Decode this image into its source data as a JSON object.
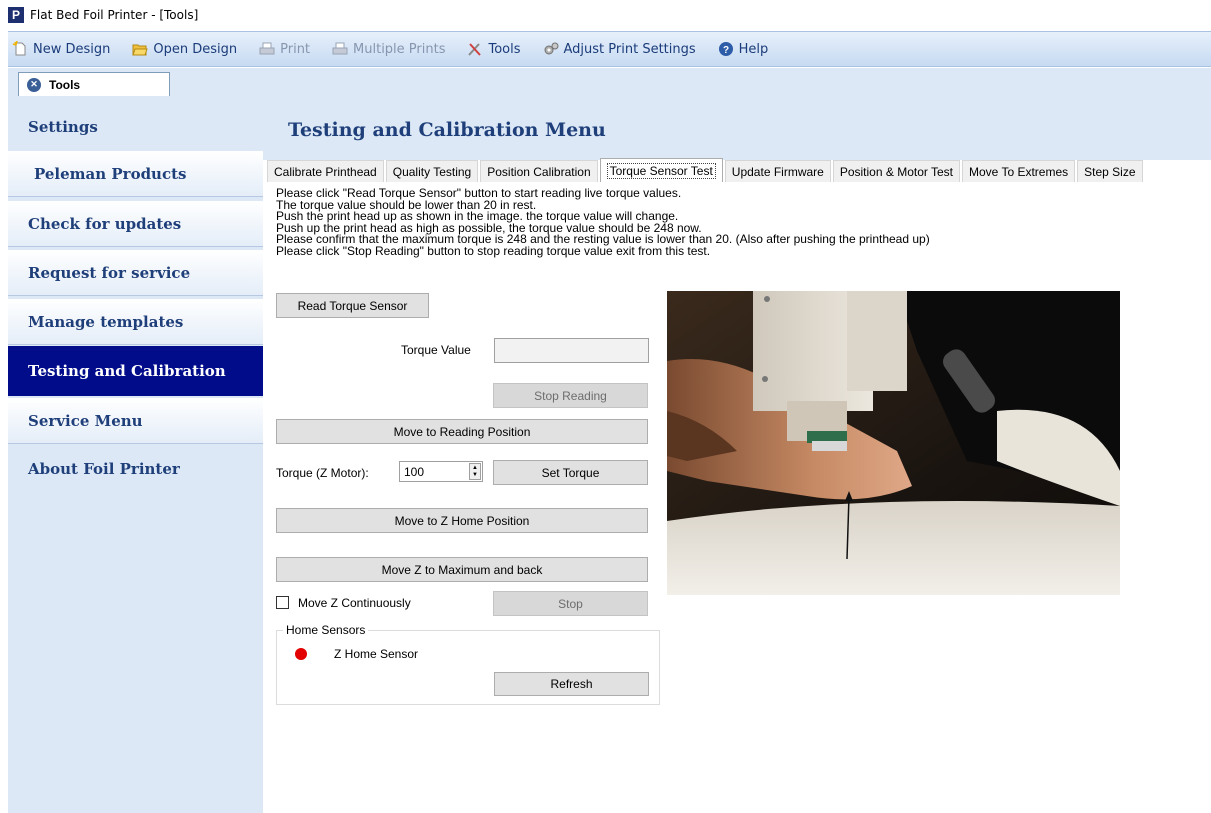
{
  "window": {
    "title": "Flat Bed Foil Printer - [Tools]",
    "app_icon_letter": "P"
  },
  "toolbar": {
    "new_design": "New Design",
    "open_design": "Open Design",
    "print": "Print",
    "multiple_prints": "Multiple Prints",
    "tools": "Tools",
    "adjust_print_settings": "Adjust Print Settings",
    "help": "Help"
  },
  "doc_tab": {
    "label": "Tools"
  },
  "sidebar": {
    "items": [
      {
        "label": "Settings"
      },
      {
        "label": "Peleman Products"
      },
      {
        "label": "Check for updates"
      },
      {
        "label": "Request for service"
      },
      {
        "label": "Manage templates"
      },
      {
        "label": "Testing and Calibration"
      },
      {
        "label": "Service Menu"
      },
      {
        "label": "About Foil Printer"
      }
    ]
  },
  "main": {
    "title": "Testing and Calibration Menu",
    "tabs": [
      {
        "label": "Calibrate Printhead"
      },
      {
        "label": "Quality Testing"
      },
      {
        "label": "Position Calibration"
      },
      {
        "label": "Torque Sensor Test"
      },
      {
        "label": "Update Firmware"
      },
      {
        "label": "Position & Motor Test"
      },
      {
        "label": "Move To Extremes"
      },
      {
        "label": "Step Size"
      }
    ],
    "instructions": [
      "Please click \"Read Torque Sensor\" button to start reading live torque values.",
      "The torque value should be lower than 20 in rest.",
      "Push the print head up as shown in the image. the torque value will change.",
      "Push up the print head as high as possible, the torque value should be 248 now.",
      "Please confirm that the maximum torque is 248 and the resting value is lower than 20. (Also after pushing the printhead up)",
      "Please click \"Stop Reading\" button to stop reading torque value  exit from this test."
    ],
    "read_torque_sensor": "Read Torque Sensor",
    "torque_value_label": "Torque Value",
    "torque_value": "",
    "stop_reading": "Stop Reading",
    "move_to_reading_position": "Move to Reading Position",
    "torque_z_motor_label": "Torque (Z Motor):",
    "torque_z_motor_value": "100",
    "set_torque": "Set Torque",
    "move_to_z_home": "Move to Z Home Position",
    "move_z_max_back": "Move Z to Maximum and back",
    "move_z_continuously": "Move Z Continuously",
    "stop": "Stop",
    "home_sensors": {
      "title": "Home Sensors",
      "z_home_sensor": "Z Home Sensor",
      "refresh": "Refresh"
    }
  },
  "colors": {
    "accent": "#1f3f7a",
    "active_sidebar": "#000c8a",
    "sensor_led": "#e20000",
    "panel_bg": "#dce8f6"
  }
}
